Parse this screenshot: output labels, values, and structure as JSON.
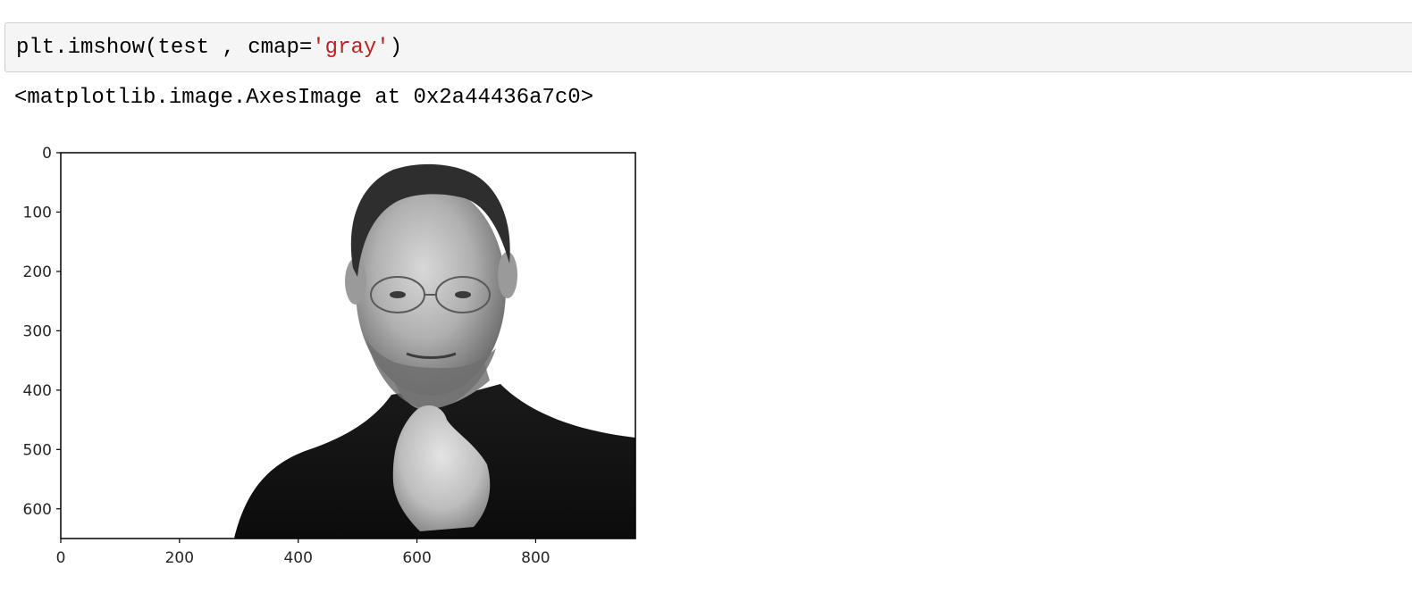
{
  "cell": {
    "code_parts": [
      {
        "kind": "plain",
        "text": "plt.imshow(test , cmap="
      },
      {
        "kind": "string",
        "text": "'gray'"
      },
      {
        "kind": "plain",
        "text": ")"
      }
    ],
    "output_text": "<matplotlib.image.AxesImage at 0x2a44436a7c0>"
  },
  "colors": {
    "cell_background": "#f5f5f5",
    "cell_border": "#cfcfcf",
    "string_token": "#ba2121"
  },
  "chart_data": {
    "type": "image",
    "cmap": "gray",
    "xlim": [
      0,
      968
    ],
    "ylim": [
      650,
      0
    ],
    "x_ticks": [
      {
        "value": 0,
        "label": "0"
      },
      {
        "value": 200,
        "label": "200"
      },
      {
        "value": 400,
        "label": "400"
      },
      {
        "value": 600,
        "label": "600"
      },
      {
        "value": 800,
        "label": "800"
      }
    ],
    "y_ticks": [
      {
        "value": 0,
        "label": "0"
      },
      {
        "value": 100,
        "label": "100"
      },
      {
        "value": 200,
        "label": "200"
      },
      {
        "value": 300,
        "label": "300"
      },
      {
        "value": 400,
        "label": "400"
      },
      {
        "value": 500,
        "label": "500"
      },
      {
        "value": 600,
        "label": "600"
      }
    ]
  }
}
